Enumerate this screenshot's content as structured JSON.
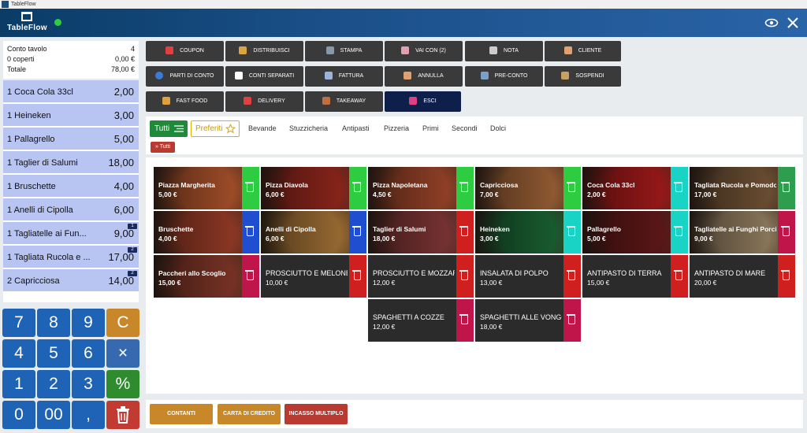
{
  "window": {
    "title": "TableFlow"
  },
  "header": {
    "logo_text": "TableFlow"
  },
  "summary": {
    "rows": [
      {
        "label": "Conto tavolo",
        "value": "4"
      },
      {
        "label": "0 coperti",
        "value": "0,00 €"
      },
      {
        "label": "Totale",
        "value": "78,00 €"
      }
    ]
  },
  "order": {
    "items": [
      {
        "name": "1 Coca Cola 33cl",
        "price": "2,00",
        "badge": ""
      },
      {
        "name": "1 Heineken",
        "price": "3,00",
        "badge": ""
      },
      {
        "name": "1 Pallagrello",
        "price": "5,00",
        "badge": ""
      },
      {
        "name": "1 Taglier di Salumi",
        "price": "18,00",
        "badge": ""
      },
      {
        "name": "1 Bruschette",
        "price": "4,00",
        "badge": ""
      },
      {
        "name": "1 Anelli di Cipolla",
        "price": "6,00",
        "badge": ""
      },
      {
        "name": "1 Tagliatelle ai Fun...",
        "price": "9,00",
        "badge": "1"
      },
      {
        "name": "1 Tagliata Rucola e ...",
        "price": "17,00",
        "badge": "2"
      },
      {
        "name": "2 Capricciosa",
        "price": "14,00",
        "badge": "2"
      }
    ]
  },
  "keypad": {
    "keys": [
      "7",
      "8",
      "9",
      "C",
      "4",
      "5",
      "6",
      "×",
      "1",
      "2",
      "3",
      "%",
      "0",
      "00",
      ",",
      ""
    ]
  },
  "actions": {
    "buttons": [
      {
        "label": "COUPON",
        "icon": "gift-icon",
        "icon_color": "#e04040"
      },
      {
        "label": "DISTRIBUISCI",
        "icon": "pan-icon",
        "icon_color": "#d9a441"
      },
      {
        "label": "STAMPA",
        "icon": "printer-icon",
        "icon_color": "#8899aa"
      },
      {
        "label": "VAI CON (2)",
        "icon": "person-icon",
        "icon_color": "#e0a0b0"
      },
      {
        "label": "NOTA",
        "icon": "note-icon",
        "icon_color": "#cccccc"
      },
      {
        "label": "CLIENTE",
        "icon": "customer-icon",
        "icon_color": "#e0a070"
      },
      {
        "label": "PARTI DI CONTO",
        "icon": "pie-icon",
        "icon_color": "#3a7bd5"
      },
      {
        "label": "CONTI SEPARATI",
        "icon": "split-icon",
        "icon_color": "#ffffff"
      },
      {
        "label": "FATTURA",
        "icon": "invoice-icon",
        "icon_color": "#9bb4d9"
      },
      {
        "label": "ANNULLA",
        "icon": "handshake-icon",
        "icon_color": "#e0a070"
      },
      {
        "label": "PRE-CONTO",
        "icon": "cash-stack-icon",
        "icon_color": "#7aa0c8"
      },
      {
        "label": "SOSPENDI",
        "icon": "hourglass-icon",
        "icon_color": "#c8a060"
      },
      {
        "label": "FAST FOOD",
        "icon": "burger-icon",
        "icon_color": "#e0a040"
      },
      {
        "label": "DELIVERY",
        "icon": "scooter-icon",
        "icon_color": "#e04040"
      },
      {
        "label": "TAKEAWAY",
        "icon": "bag-icon",
        "icon_color": "#c07040"
      },
      {
        "label": "ESCI",
        "icon": "exit-icon",
        "icon_color": "#e04080"
      }
    ]
  },
  "categories": {
    "all_label": "Tutti",
    "favorites_label": "Preferiti",
    "items": [
      "Bevande",
      "Stuzzicheria",
      "Antipasti",
      "Pizzeria",
      "Primi",
      "Secondi",
      "Dolci"
    ],
    "breadcrumb": "» Tutti"
  },
  "products": [
    {
      "name": "Piazza Margherita",
      "price": "5,00 €",
      "side": "#2ecc40",
      "img": "#b8582e"
    },
    {
      "name": "Pizza Diavola",
      "price": "6,00 €",
      "side": "#2ecc40",
      "img": "#9e2a1f"
    },
    {
      "name": "Pizza Napoletana",
      "price": "4,50 €",
      "side": "#2ecc40",
      "img": "#a74a2c"
    },
    {
      "name": "Capricciosa",
      "price": "7,00 €",
      "side": "#2ecc40",
      "img": "#a8683a"
    },
    {
      "name": "Coca Cola 33cl",
      "price": "2,00 €",
      "side": "#19d3c5",
      "img": "#b01c1c"
    },
    {
      "name": "Tagliata Rucola e Pomodoro",
      "price": "17,00 €",
      "side": "#2e9e4e",
      "img": "#7c5a3a"
    },
    {
      "name": "Bruschette",
      "price": "4,00 €",
      "side": "#1f4fd0",
      "img": "#a3402a"
    },
    {
      "name": "Anelli di Cipolla",
      "price": "6,00 €",
      "side": "#1f4fd0",
      "img": "#b07a3a"
    },
    {
      "name": "Taglier di Salumi",
      "price": "18,00 €",
      "side": "#d01f1f",
      "img": "#8a3a3a"
    },
    {
      "name": "Heineken",
      "price": "3,00 €",
      "side": "#19d3c5",
      "img": "#1d6b38"
    },
    {
      "name": "Pallagrello",
      "price": "5,00 €",
      "side": "#19d3c5",
      "img": "#6a1a1a"
    },
    {
      "name": "Tagliatelle ai Funghi Porcini",
      "price": "9,00 €",
      "side": "#c0154a",
      "img": "#a08a6a"
    },
    {
      "name": "Paccheri allo Scoglio",
      "price": "15,00 €",
      "side": "#c0154a",
      "img": "#8a3a2a"
    },
    {
      "name": "PROSCIUTTO E MELONE",
      "price": "10,00 €",
      "side": "#d01f1f",
      "img": ""
    },
    {
      "name": "PROSCIUTTO E MOZZARELLA",
      "price": "12,00 €",
      "side": "#d01f1f",
      "img": ""
    },
    {
      "name": "INSALATA DI POLPO",
      "price": "13,00 €",
      "side": "#d01f1f",
      "img": ""
    },
    {
      "name": "ANTIPASTO DI TERRA",
      "price": "15,00 €",
      "side": "#d01f1f",
      "img": ""
    },
    {
      "name": "ANTIPASTO DI MARE",
      "price": "20,00 €",
      "side": "#d01f1f",
      "img": ""
    },
    {
      "name": "SPAGHETTI A COZZE",
      "price": "12,00 €",
      "side": "#c0154a",
      "img": ""
    },
    {
      "name": "SPAGHETTI ALLE VONGOLE",
      "price": "18,00 €",
      "side": "#c0154a",
      "img": ""
    }
  ],
  "payment": {
    "buttons": [
      {
        "label": "CONTANTI",
        "color": "#c8882a"
      },
      {
        "label": "CARTA DI CREDITO",
        "color": "#c8882a"
      },
      {
        "label": "INCASSO MULTIPLO",
        "color": "#b83a30"
      }
    ]
  }
}
